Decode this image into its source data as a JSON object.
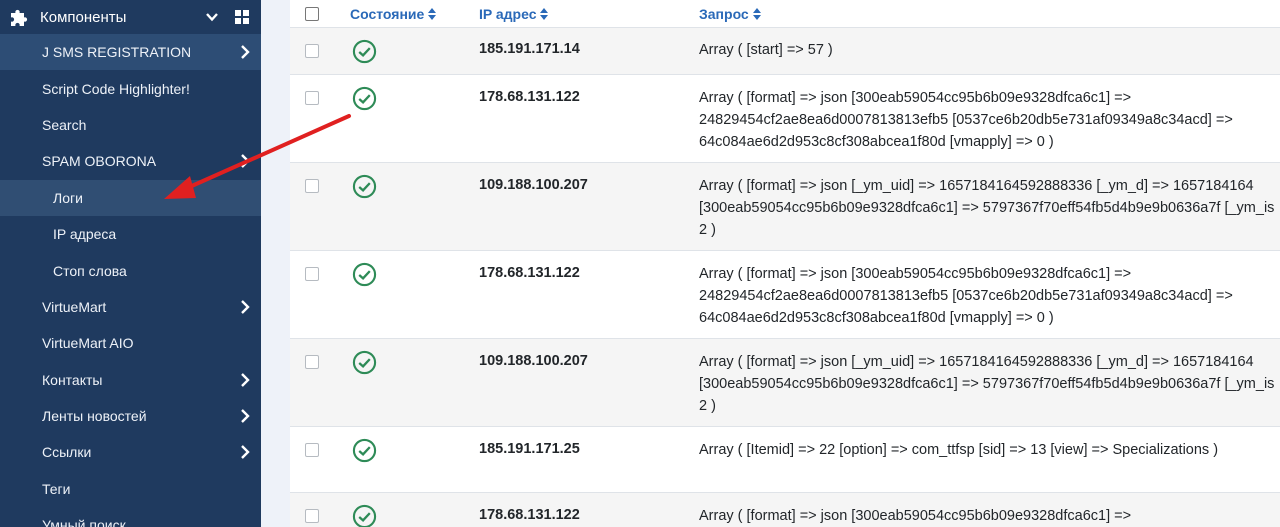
{
  "sidebar": {
    "header": "Компоненты",
    "items": [
      {
        "label": "J SMS REGISTRATION",
        "has_children": true
      },
      {
        "label": "Script Code Highlighter!",
        "has_children": false
      },
      {
        "label": "Search",
        "has_children": false
      },
      {
        "label": "SPAM OBORONA",
        "has_children": true
      },
      {
        "label": "Логи",
        "has_children": false
      },
      {
        "label": "IP адреса",
        "has_children": false
      },
      {
        "label": "Стоп слова",
        "has_children": false
      },
      {
        "label": "VirtueMart",
        "has_children": true
      },
      {
        "label": "VirtueMart AIO",
        "has_children": false
      },
      {
        "label": "Контакты",
        "has_children": true
      },
      {
        "label": "Ленты новостей",
        "has_children": true
      },
      {
        "label": "Ссылки",
        "has_children": true
      },
      {
        "label": "Теги",
        "has_children": false
      },
      {
        "label": "Умный поиск",
        "has_children": false
      }
    ]
  },
  "table": {
    "headers": {
      "status": "Состояние",
      "ip": "IP адрес",
      "request": "Запрос"
    },
    "rows": [
      {
        "status": "ok",
        "ip": "185.191.171.14",
        "request": "Array ( [start] => 57 )"
      },
      {
        "status": "ok",
        "ip": "178.68.131.122",
        "request": "Array ( [format] => json [300eab59054cc95b6b09e9328dfca6c1] => 24829454cf2ae8ea6d0007813813efb5 [0537ce6b20db5e731af09349a8c34acd] => 64c084ae6d2d953c8cf308abcea1f80d [vmapply] => 0 )"
      },
      {
        "status": "ok",
        "ip": "109.188.100.207",
        "request": "Array ( [format] => json [_ym_uid] => 1657184164592888336 [_ym_d] => 1657184164 [300eab59054cc95b6b09e9328dfca6c1] => 5797367f70eff54fb5d4b9e9b0636a7f [_ym_is 2 )"
      },
      {
        "status": "ok",
        "ip": "178.68.131.122",
        "request": "Array ( [format] => json [300eab59054cc95b6b09e9328dfca6c1] => 24829454cf2ae8ea6d0007813813efb5 [0537ce6b20db5e731af09349a8c34acd] => 64c084ae6d2d953c8cf308abcea1f80d [vmapply] => 0 )"
      },
      {
        "status": "ok",
        "ip": "109.188.100.207",
        "request": "Array ( [format] => json [_ym_uid] => 1657184164592888336 [_ym_d] => 1657184164 [300eab59054cc95b6b09e9328dfca6c1] => 5797367f70eff54fb5d4b9e9b0636a7f [_ym_is 2 )"
      },
      {
        "status": "ok",
        "ip": "185.191.171.25",
        "request": "Array ( [Itemid] => 22 [option] => com_ttfsp [sid] => 13 [view] => Specializations )"
      },
      {
        "status": "ok",
        "ip": "178.68.131.122",
        "request": "Array ( [format] => json [300eab59054cc95b6b09e9328dfca6c1] =>"
      }
    ]
  },
  "colors": {
    "sidebar_bg": "#1f3a5f",
    "accent": "#2a69b8",
    "status_ok": "#2e8b57",
    "annotation_arrow": "#e02020"
  }
}
